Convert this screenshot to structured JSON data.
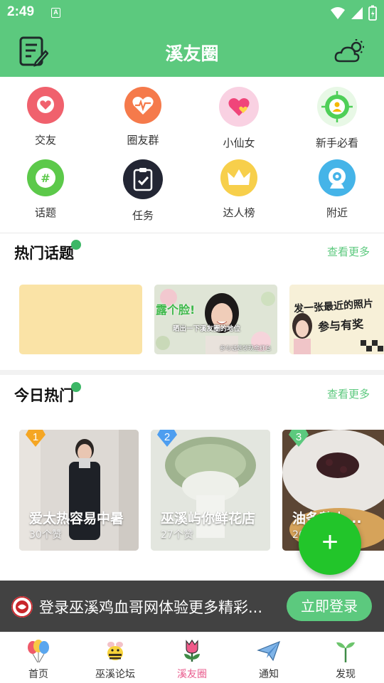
{
  "status_bar": {
    "time": "2:49",
    "notification_badge": "A"
  },
  "header": {
    "title": "溪友圈"
  },
  "categories": [
    {
      "label": "交友",
      "icon": "heart-chat-icon",
      "color": "#f0616d"
    },
    {
      "label": "圈友群",
      "icon": "heartbeat-icon",
      "color": "#f57a4b"
    },
    {
      "label": "小仙女",
      "icon": "pink-heart-icon",
      "color": "#f7c0d6"
    },
    {
      "label": "新手必看",
      "icon": "target-person-icon",
      "color": "#4fcf58"
    },
    {
      "label": "话题",
      "icon": "hashtag-icon",
      "color": "#5cc94a"
    },
    {
      "label": "任务",
      "icon": "clipboard-check-icon",
      "color": "#232634"
    },
    {
      "label": "达人榜",
      "icon": "crown-icon",
      "color": "#f7cf4b"
    },
    {
      "label": "附近",
      "icon": "location-camera-icon",
      "color": "#45b4e8"
    }
  ],
  "hot_topics": {
    "title": "热门话题",
    "more": "查看更多",
    "cards": [
      {
        "image": "blank-yellow-card",
        "overlay": ""
      },
      {
        "image": "smiling-girl-flowers-image",
        "overlay": "露个脸!",
        "sub": "晒出一下溪友圈的地位",
        "tag": "参与话题领现金红包"
      },
      {
        "image": "recent-photo-topic-image",
        "overlay": "发一张最近的照片",
        "sub": "参与有奖"
      }
    ]
  },
  "today_hot": {
    "title": "今日热门",
    "more": "查看更多",
    "cards": [
      {
        "rank": "1",
        "title": "爱太热容易中暑",
        "likes": "30个赞",
        "rank_color": "#f5a623"
      },
      {
        "rank": "2",
        "title": "巫溪屿你鲜花店",
        "likes": "27个赞",
        "rank_color": "#4d9ef0"
      },
      {
        "rank": "3",
        "title": "油条蘸上...",
        "likes": "26个赞",
        "rank_color": "#5cc97e"
      }
    ]
  },
  "fab": {
    "label": "+"
  },
  "login_banner": {
    "text": "登录巫溪鸡血哥网体验更多精彩...",
    "button": "立即登录"
  },
  "tabs": [
    {
      "label": "首页",
      "icon": "balloons-icon",
      "active": false
    },
    {
      "label": "巫溪论坛",
      "icon": "bee-icon",
      "active": false
    },
    {
      "label": "溪友圈",
      "icon": "tulip-icon",
      "active": true
    },
    {
      "label": "通知",
      "icon": "paper-plane-icon",
      "active": false
    },
    {
      "label": "发现",
      "icon": "sprout-icon",
      "active": false
    }
  ]
}
